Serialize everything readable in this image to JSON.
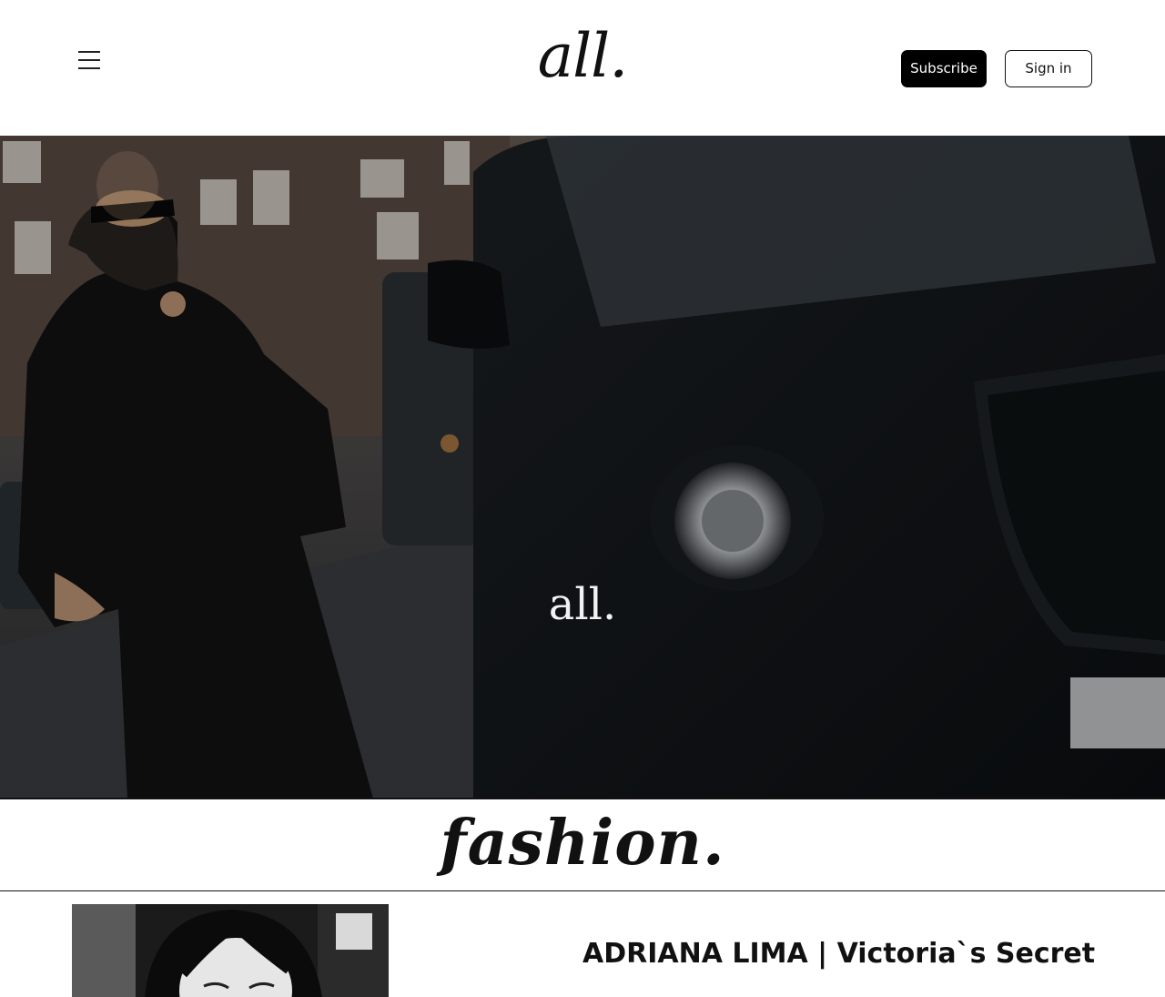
{
  "header": {
    "logo": "all.",
    "subscribe_label": "Subscribe",
    "signin_label": "Sign in"
  },
  "hero": {
    "title": "all."
  },
  "section": {
    "heading": "fashion."
  },
  "articles": [
    {
      "title": "ADRIANA LIMA | Victoria`s Secret"
    }
  ],
  "colors": {
    "background": "#ffffff",
    "text": "#111111",
    "button_primary": "#000000"
  }
}
